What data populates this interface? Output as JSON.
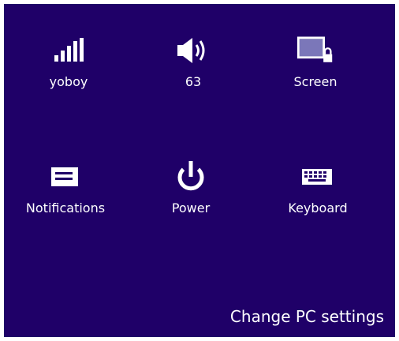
{
  "colors": {
    "panel_background": "#1f0068",
    "foreground": "#ffffff"
  },
  "tiles": [
    {
      "id": "network",
      "label": "yoboy",
      "icon": "wifi-signal-icon"
    },
    {
      "id": "volume",
      "label": "63",
      "icon": "speaker-icon"
    },
    {
      "id": "screen",
      "label": "Screen",
      "icon": "screen-lock-icon"
    },
    {
      "id": "notifications",
      "label": "Notifications",
      "icon": "notifications-icon"
    },
    {
      "id": "power",
      "label": "Power",
      "icon": "power-icon"
    },
    {
      "id": "keyboard",
      "label": "Keyboard",
      "icon": "keyboard-icon"
    }
  ],
  "footer": {
    "change_pc_settings": "Change PC settings"
  }
}
